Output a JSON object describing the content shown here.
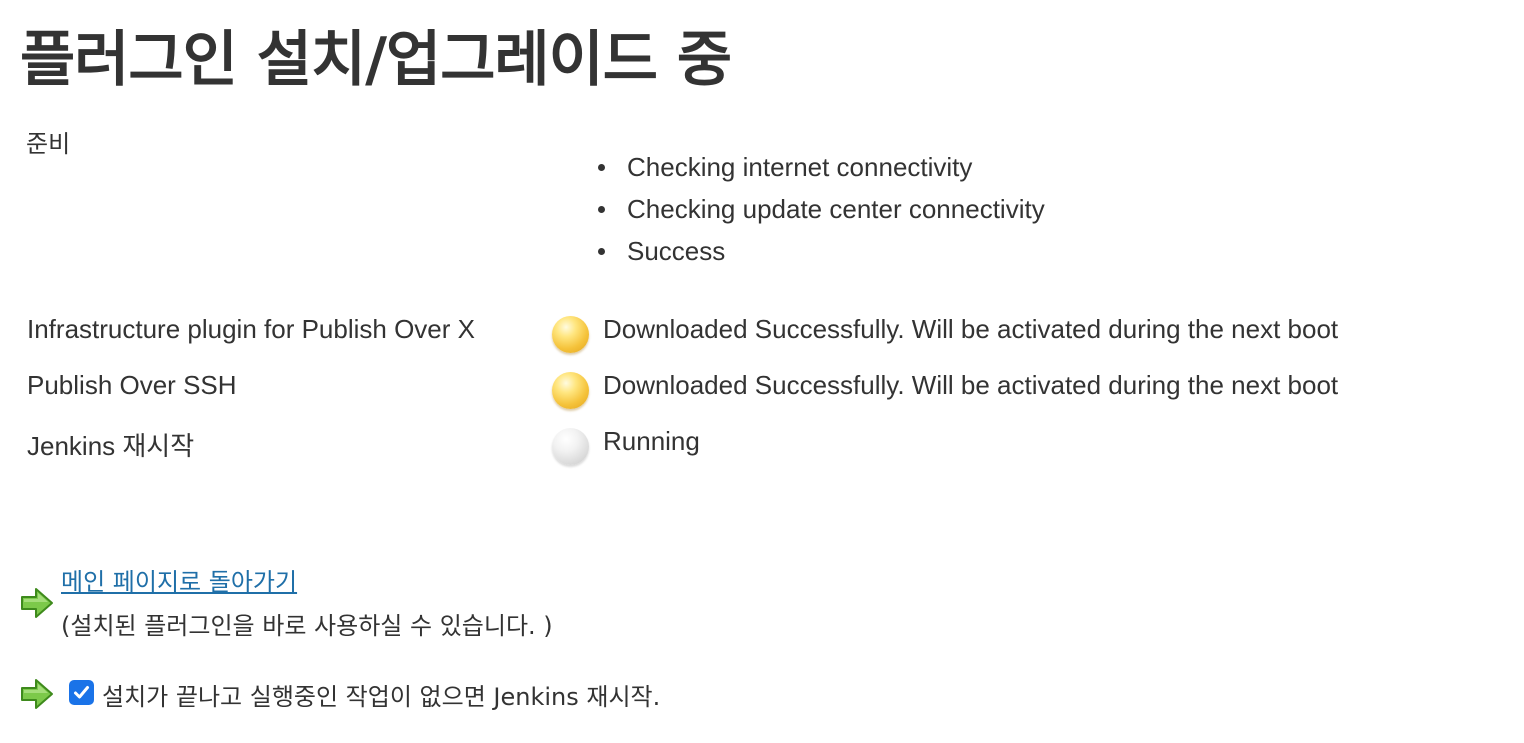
{
  "page": {
    "title": "플러그인 설치/업그레이드 중"
  },
  "preparation": {
    "label": "준비",
    "steps": [
      "Checking internet connectivity",
      "Checking update center connectivity",
      "Success"
    ]
  },
  "jobs": [
    {
      "name": "Infrastructure plugin for Publish Over X",
      "status_icon": "yellow-ball-icon",
      "status": "Downloaded Successfully. Will be activated during the next boot"
    },
    {
      "name": "Publish Over SSH",
      "status_icon": "yellow-ball-icon",
      "status": "Downloaded Successfully. Will be activated during the next boot"
    },
    {
      "name": "Jenkins 재시작",
      "status_icon": "grey-ball-icon",
      "status": "Running"
    }
  ],
  "footer": {
    "back_link": "메인 페이지로 돌아가기",
    "back_note": "(설치된 플러그인을 바로 사용하실 수 있습니다. )",
    "restart_label": "설치가 끝나고 실행중인 작업이 없으면 Jenkins 재시작.",
    "restart_checked": true,
    "arrow_icon": "green-arrow-icon"
  },
  "colors": {
    "text": "#333333",
    "link": "#1f6fa8",
    "checkbox": "#1a73e8",
    "arrow_green": "#5cb82c"
  }
}
